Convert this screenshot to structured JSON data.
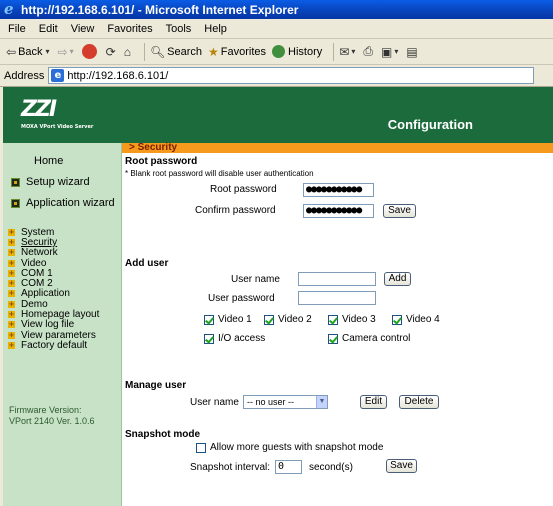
{
  "browser": {
    "title": "http://192.168.6.101/ - Microsoft Internet Explorer",
    "menu": [
      "File",
      "Edit",
      "View",
      "Favorites",
      "Tools",
      "Help"
    ],
    "toolbar": {
      "back": "Back",
      "search": "Search",
      "favorites": "Favorites",
      "history": "History"
    },
    "address_label": "Address",
    "address_value": "http://192.168.6.101/"
  },
  "header": {
    "logo_mark": "ZZI",
    "logo_tag": "MOXA VPort Video Server",
    "title": "Configuration"
  },
  "sidebar": {
    "home": "Home",
    "setup_wizard": "Setup wizard",
    "application_wizard": "Application wizard",
    "items": [
      "System",
      "Security",
      "Network",
      "Video",
      "COM 1",
      "COM 2",
      "Application",
      "Demo",
      "Homepage layout",
      "View log file",
      "View parameters",
      "Factory default"
    ],
    "active": "Security",
    "firmware_label": "Firmware Version:",
    "firmware_value": "VPort 2140 Ver. 1.0.6"
  },
  "content": {
    "section": "> Security",
    "root": {
      "heading": "Root password",
      "note": "* Blank root password will disable user authentication",
      "root_password_label": "Root password",
      "root_password_value": "●●●●●●●●●●●",
      "confirm_label": "Confirm password",
      "confirm_value": "●●●●●●●●●●●",
      "save": "Save"
    },
    "add_user": {
      "heading": "Add user",
      "user_name_label": "User name",
      "user_name_value": "",
      "add": "Add",
      "user_password_label": "User password",
      "user_password_value": "",
      "checks": [
        {
          "label": "Video 1",
          "checked": true
        },
        {
          "label": "Video 2",
          "checked": true
        },
        {
          "label": "Video 3",
          "checked": true
        },
        {
          "label": "Video 4",
          "checked": true
        },
        {
          "label": "I/O access",
          "checked": true
        },
        {
          "label": "Camera control",
          "checked": true
        }
      ]
    },
    "manage_user": {
      "heading": "Manage user",
      "user_name_label": "User name",
      "select_value": "-- no user --",
      "edit": "Edit",
      "delete": "Delete"
    },
    "snapshot": {
      "heading": "Snapshot mode",
      "allow_guests": "Allow more guests with snapshot mode",
      "allow_checked": false,
      "interval_label": "Snapshot interval:",
      "interval_value": "0",
      "interval_unit": "second(s)",
      "save": "Save"
    }
  },
  "colors": {
    "header_green": "#1c6b3c",
    "sidebar_green": "#c7e2c7",
    "section_orange": "#f59a1c"
  }
}
